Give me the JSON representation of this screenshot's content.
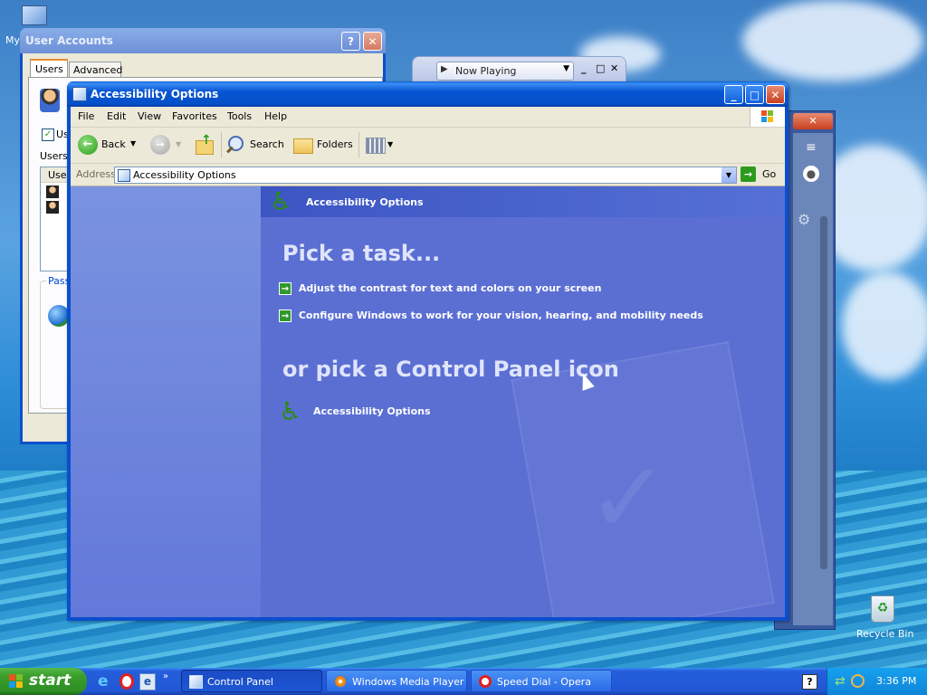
{
  "desktop": {
    "icon_my_label": "My",
    "recycle_bin_label": "Recycle Bin"
  },
  "user_accounts": {
    "title": "User Accounts",
    "tab_users": "Users",
    "tab_advanced": "Advanced",
    "checkbox_label": "Us",
    "users_label": "Users",
    "column_user": "Use",
    "password_label": "Pass"
  },
  "now_playing": {
    "label": "Now Playing"
  },
  "main_window": {
    "title": "Accessibility Options",
    "menu": [
      "File",
      "Edit",
      "View",
      "Favorites",
      "Tools",
      "Help"
    ],
    "toolbar": {
      "back": "Back",
      "search": "Search",
      "folders": "Folders"
    },
    "address": {
      "label": "Address",
      "value": "Accessibility Options",
      "go": "Go"
    },
    "content": {
      "header": "Accessibility Options",
      "pick_task": "Pick a task...",
      "tasks": [
        "Adjust the contrast for text and colors on your screen",
        "Configure Windows to work for your vision, hearing, and mobility needs"
      ],
      "pick_icon": "or pick a Control Panel icon",
      "icon_label": "Accessibility Options"
    }
  },
  "taskbar": {
    "start": "start",
    "tasks": [
      "Control Panel",
      "Windows Media Player",
      "Speed Dial - Opera"
    ],
    "clock": "3:36 PM"
  },
  "colors": {
    "title_blue": "#0754d4",
    "content_blue": "#5b6fd3",
    "start_green": "#3a9d2b",
    "tray_blue": "#0f85d8"
  }
}
